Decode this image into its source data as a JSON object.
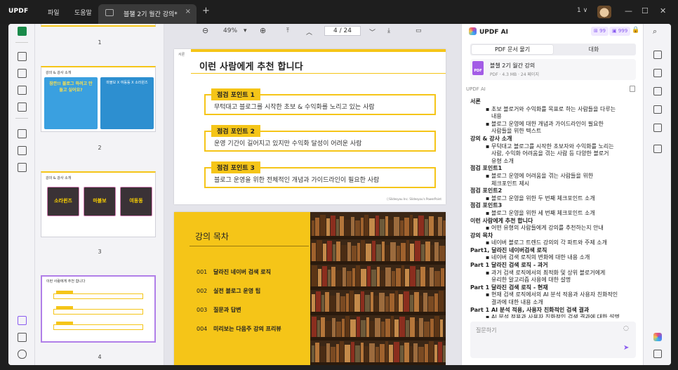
{
  "app": {
    "logo": "UPDF",
    "menu": [
      "파일",
      "도움말"
    ],
    "tab_title": "블챌 2기 월간 강의*",
    "tab_close": "×",
    "tab_add": "+",
    "window_count": "1 ∨",
    "window_buttons": [
      "—",
      "☐",
      "✕"
    ]
  },
  "toolbar": {
    "zoom_out": "⊖",
    "zoom": "49%",
    "zoom_dropdown": "▾",
    "zoom_in": "⊕",
    "first_page": "⤒",
    "prev_page": "︿",
    "page_current": "4",
    "page_sep": "/",
    "page_total": "24",
    "next_page": "﹀",
    "last_page": "⤓",
    "comment": "▭"
  },
  "thumbnails": [
    {
      "num": "1"
    },
    {
      "num": "2",
      "title": "강의 & 강사 소개",
      "left_text": "잠깐!! 블로그 하려고 만들고 싶어요?",
      "right_text": "마블보 X 여동동 X 소라윈즈"
    },
    {
      "num": "3",
      "title": "강의 & 강사 소개",
      "cards": [
        "소라윈즈",
        "마블보",
        "여동동"
      ]
    },
    {
      "num": "4",
      "title": "이런 사람에게 추천 합니다"
    }
  ],
  "page1": {
    "label": "서론",
    "title": "이런 사람에게 추천 합니다",
    "points": [
      {
        "tag": "점검 포인트 1",
        "text": "무턱대고 블로그를 시작한 초보 & 수익화를 노리고 있는 사람"
      },
      {
        "tag": "점검 포인트 2",
        "text": "운영 기간이 길어지고 있지만 수익화 달성이 어려운 사람"
      },
      {
        "tag": "점검 포인트 3",
        "text": "블로그 운영을 위한 전체적인 개념과 가이드라인이 필요한 사람"
      }
    ],
    "footer": "ⓒSlidesyou Inc. Slidesyou's PowerPoint"
  },
  "page2": {
    "title": "강의 목차",
    "items": [
      {
        "num": "001",
        "text": "달라진 네이버 검색 로직"
      },
      {
        "num": "002",
        "text": "실전 블로그 운영 팁"
      },
      {
        "num": "003",
        "text": "질문과 답변"
      },
      {
        "num": "004",
        "text": "미리보는 다음주 강의 프리뷰"
      }
    ]
  },
  "ai": {
    "title": "UPDF AI",
    "credit1": "⊞ 99",
    "credit2": "▣ 999",
    "lock": "🔒",
    "tab_summary": "PDF 문서 물기",
    "tab_chat": "대화",
    "file_name": "블챌 2기 월간 강의",
    "file_meta": "PDF · 4.3 MB · 24 페이지",
    "pdf_badge": "PDF",
    "label": "UPDF AI",
    "summary": [
      {
        "k": "h",
        "t": "서론"
      },
      {
        "k": "b",
        "t": "▪ 초보 블로거와 수익화를 목표로 하는 사람들을 다루는"
      },
      {
        "k": "c",
        "t": "내용"
      },
      {
        "k": "b",
        "t": "▪ 블로그 운영에 대한 개념과 가이드라인이 필요한"
      },
      {
        "k": "c",
        "t": "사람들을 위한 텍스트"
      },
      {
        "k": "h",
        "t": "강의 & 강사 소개"
      },
      {
        "k": "b",
        "t": "▪ 무턱대고 블로그를 시작한 초보자와 수익화를 노리는"
      },
      {
        "k": "c",
        "t": "사람, 수익화 어려움을 겪는 사람 등 다양한 블로거"
      },
      {
        "k": "c",
        "t": "유형 소개"
      },
      {
        "k": "h",
        "t": "점검 포인트1"
      },
      {
        "k": "b",
        "t": "▪ 블로그 운영에 어려움을 겪는 사람들을 위한"
      },
      {
        "k": "c",
        "t": "체크포인트 제시"
      },
      {
        "k": "h",
        "t": "점검 포인트2"
      },
      {
        "k": "b",
        "t": "▪ 블로그 운영을 위한 두 번째 체크포인트 소개"
      },
      {
        "k": "h",
        "t": "점검 포인트3"
      },
      {
        "k": "b",
        "t": "▪ 블로그 운영을 위한 세 번째 체크포인트 소개"
      },
      {
        "k": "h",
        "t": "이런 사람에게 추천 합니다"
      },
      {
        "k": "b",
        "t": "▪ 어떤 유형의 사람들에게 강의를 추천하는지 안내"
      },
      {
        "k": "h",
        "t": "강의 목차"
      },
      {
        "k": "b",
        "t": "▪ 네이버 블로그 트렌드 강의의 각 파트와 주제 소개"
      },
      {
        "k": "h",
        "t": "Part1, 달라진 네이버검색 로직"
      },
      {
        "k": "b",
        "t": "▪ 네이버 검색 로직의 변화에 대한 내용 소개"
      },
      {
        "k": "h",
        "t": "Part 1 달라진 검색 로직 - 과거"
      },
      {
        "k": "b",
        "t": "▪ 과거 검색 로직에서의 최적화 및 상위 블로거에게"
      },
      {
        "k": "c",
        "t": "유리한 알고리즘 사용에 대한 설명"
      },
      {
        "k": "h",
        "t": "Part 1 달라진 검색 로직 - 현재"
      },
      {
        "k": "b",
        "t": "▪ 현재 검색 로직에서의 AI 분석 적용과 사용자 친화적인"
      },
      {
        "k": "c",
        "t": "결과에 대한 내용 소개"
      },
      {
        "k": "h",
        "t": "Part 1 AI 분석 적용, 사용자 친화적인 검색 결과"
      },
      {
        "k": "b",
        "t": "▪ AI 분석 적용과 사용자 친화적인 검색 결과에 대한 설명"
      }
    ],
    "ask_placeholder": "질문하기",
    "ask_bulb": "◌",
    "ask_send": "➤"
  },
  "right_rail": {
    "search": "⌕"
  },
  "colors": {
    "accent_yellow": "#f5c518",
    "ai_purple": "#8a5cf0",
    "active_green": "#1a8a4a"
  }
}
